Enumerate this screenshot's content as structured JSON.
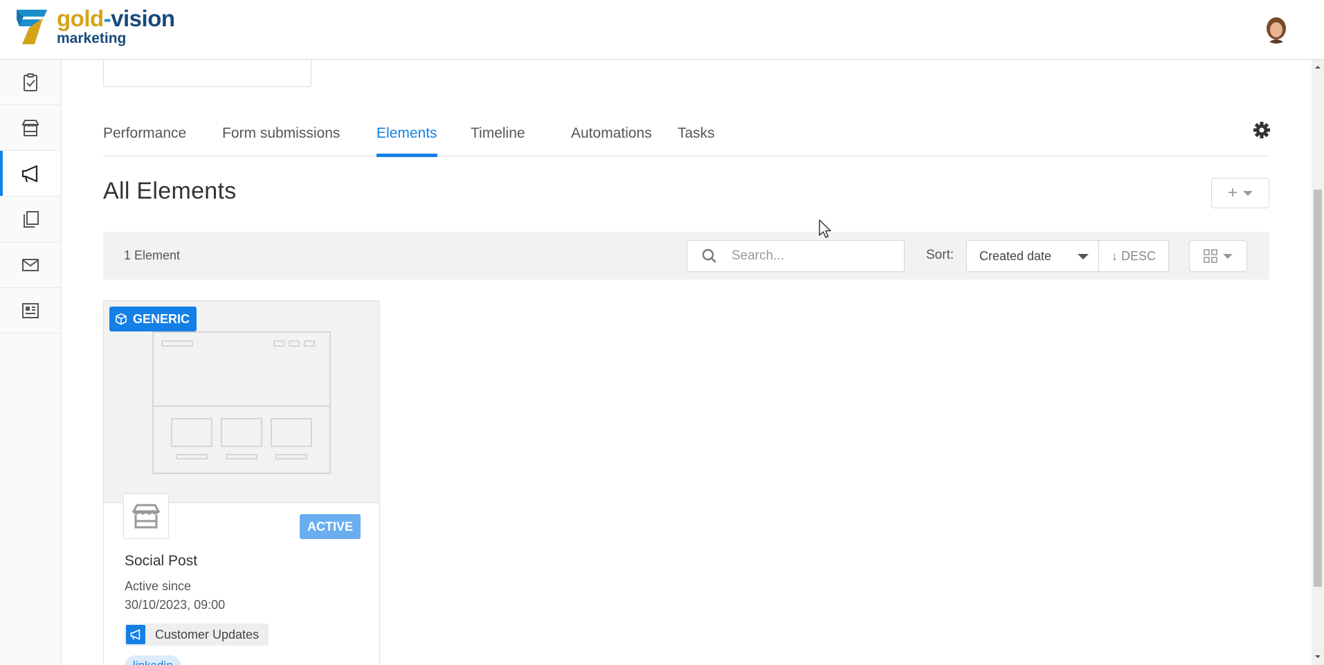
{
  "brand": {
    "line1_part1": "gold",
    "line1_dash": "-",
    "line1_part2": "vision",
    "line2": "marketing",
    "colors": {
      "gold": "#d4a319",
      "navy": "#174a7c",
      "cyan": "#1c8fcb"
    }
  },
  "header": {
    "avatar_icon": "user-avatar"
  },
  "sidebar": {
    "items": [
      {
        "icon": "clipboard-check-icon",
        "active": false
      },
      {
        "icon": "store-icon",
        "active": false
      },
      {
        "icon": "megaphone-icon",
        "active": true
      },
      {
        "icon": "copy-pages-icon",
        "active": false
      },
      {
        "icon": "envelope-icon",
        "active": false
      },
      {
        "icon": "newspaper-icon",
        "active": false
      }
    ],
    "accent": "#1480e6"
  },
  "tabs": [
    {
      "label": "Performance",
      "active": false
    },
    {
      "label": "Form submissions",
      "active": false
    },
    {
      "label": "Elements",
      "active": true
    },
    {
      "label": "Timeline",
      "active": false
    },
    {
      "label": "Automations",
      "active": false
    },
    {
      "label": "Tasks",
      "active": false
    }
  ],
  "section": {
    "title": "All Elements",
    "add_button": "+"
  },
  "toolbar": {
    "count": "1 Element",
    "search_placeholder": "Search...",
    "sort_label": "Sort:",
    "sort_value": "Created date",
    "order_label": "↓ DESC"
  },
  "cards": [
    {
      "type_badge": "GENERIC",
      "status": "ACTIVE",
      "title": "Social Post",
      "subtitle": "Active since",
      "date": "30/10/2023, 09:00",
      "campaign": "Customer Updates",
      "tag": "linkedin"
    }
  ]
}
